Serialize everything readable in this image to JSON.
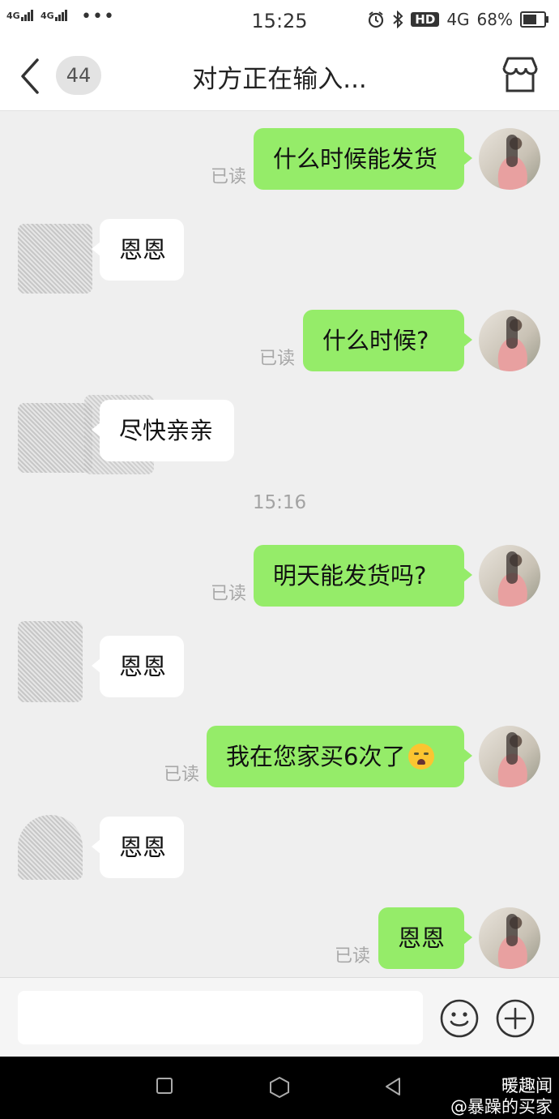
{
  "status_bar": {
    "signal1": "4G",
    "signal2": "4G",
    "dots": "•••",
    "time": "15:25",
    "hd": "HD",
    "network": "4G",
    "battery": "68%"
  },
  "header": {
    "unread_count": "44",
    "title": "对方正在输入..."
  },
  "messages": [
    {
      "dir": "out",
      "text": "什么时候能发货",
      "read": "已读"
    },
    {
      "dir": "in",
      "text": "恩恩"
    },
    {
      "dir": "out",
      "text": "什么时候?",
      "read": "已读"
    },
    {
      "dir": "in",
      "text": "尽快亲亲"
    },
    {
      "dir": "time",
      "text": "15:16"
    },
    {
      "dir": "out",
      "text": "明天能发货吗?",
      "read": "已读"
    },
    {
      "dir": "in",
      "text": "恩恩"
    },
    {
      "dir": "out",
      "text": "我在您家买6次了",
      "emoji": "crying-face-icon",
      "read": "已读"
    },
    {
      "dir": "in",
      "text": "恩恩"
    },
    {
      "dir": "out",
      "text": "恩恩",
      "read": "已读"
    }
  ],
  "input": {
    "value": "",
    "placeholder": ""
  },
  "watermark": {
    "line1": "暖趣闻",
    "line2": "@暴躁的买家"
  },
  "colors": {
    "bubble_out": "#95ec69",
    "bubble_in": "#ffffff",
    "background": "#efefef"
  }
}
